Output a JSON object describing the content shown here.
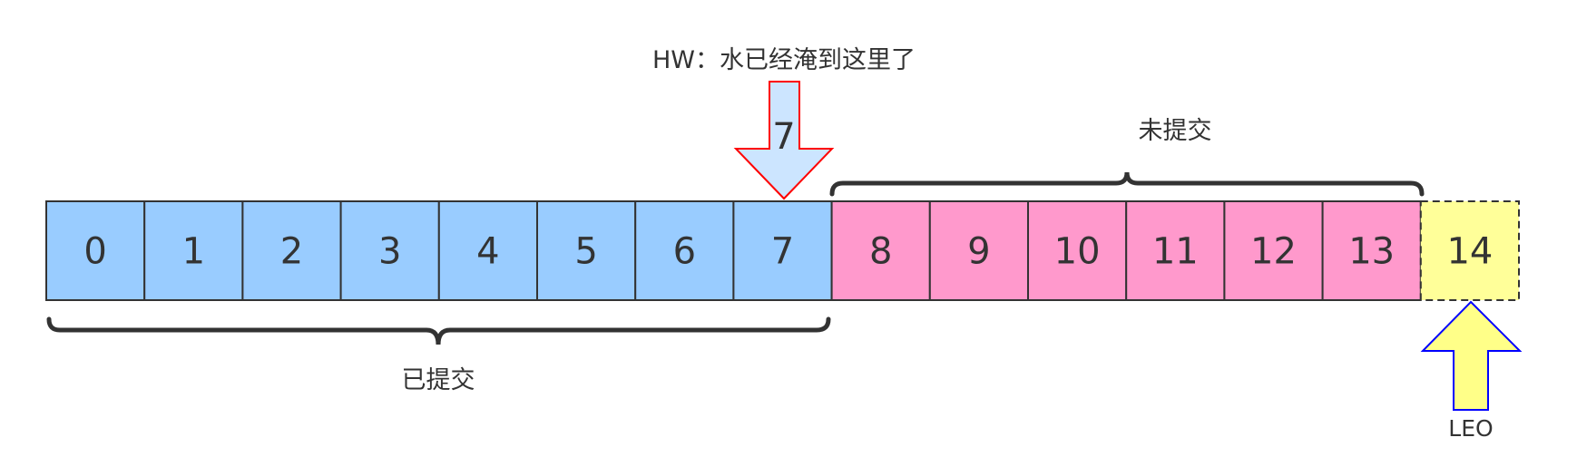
{
  "cells": [
    {
      "label": "0",
      "state": "committed"
    },
    {
      "label": "1",
      "state": "committed"
    },
    {
      "label": "2",
      "state": "committed"
    },
    {
      "label": "3",
      "state": "committed"
    },
    {
      "label": "4",
      "state": "committed"
    },
    {
      "label": "5",
      "state": "committed"
    },
    {
      "label": "6",
      "state": "committed"
    },
    {
      "label": "7",
      "state": "committed"
    },
    {
      "label": "8",
      "state": "uncommitted"
    },
    {
      "label": "9",
      "state": "uncommitted"
    },
    {
      "label": "10",
      "state": "uncommitted"
    },
    {
      "label": "11",
      "state": "uncommitted"
    },
    {
      "label": "12",
      "state": "uncommitted"
    },
    {
      "label": "13",
      "state": "uncommitted"
    },
    {
      "label": "14",
      "state": "next"
    }
  ],
  "colors": {
    "committed": "#99ccff",
    "uncommitted": "#ff99cc",
    "next": "#ffff99",
    "border": "#333333",
    "hw_arrow_fill": "#cce5ff",
    "hw_arrow_stroke": "#ff0000",
    "leo_arrow_fill": "#ffff88",
    "leo_arrow_stroke": "#0000ff"
  },
  "hw": {
    "caption": "HW：水已经淹到这里了",
    "arrow_label": "7"
  },
  "leo": {
    "caption": "LEO"
  },
  "braces": {
    "committed_label": "已提交",
    "uncommitted_label": "未提交"
  }
}
